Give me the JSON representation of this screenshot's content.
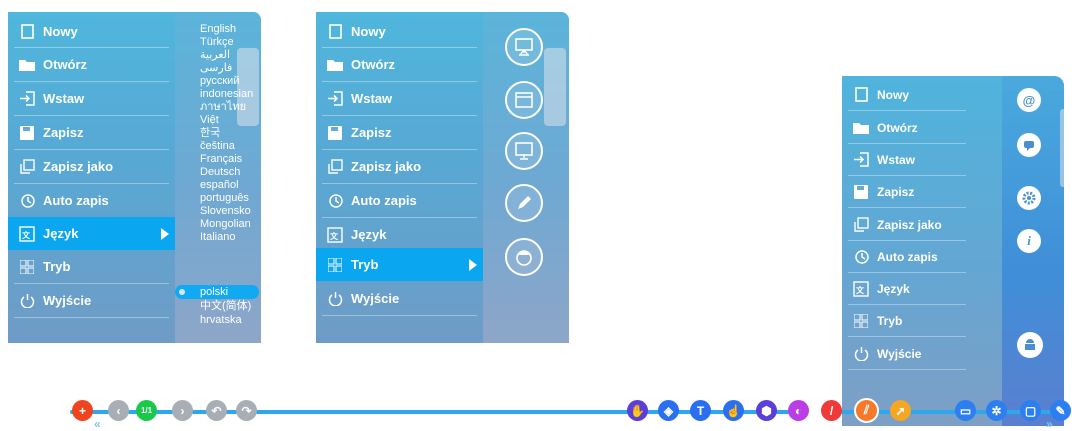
{
  "menu": {
    "new": "Nowy",
    "open": "Otwórz",
    "insert": "Wstaw",
    "save": "Zapisz",
    "save_as": "Zapisz jako",
    "auto_save": "Auto zapis",
    "language": "Język",
    "mode": "Tryb",
    "exit": "Wyjście"
  },
  "languages": [
    "English",
    "Türkçe",
    "العربية",
    "فارسی",
    "русский",
    "indonesian",
    "ภาษาไทย",
    "Việt",
    "한국",
    "čeština",
    "Français",
    "Deutsch",
    "español",
    "português",
    "Slovensko",
    "Mongolian",
    "Italiano",
    "polski",
    "中文(简体)",
    "hrvatska"
  ],
  "selected_language": "polski",
  "toolbar": {
    "page_indicator": "1/1"
  },
  "colors": {
    "accent": "#0aa6f0",
    "toolbar_bar": "#2ea7ee",
    "add_button": "#f0441f",
    "page_button": "#19c94a",
    "nav_gray": "#a9aeb5",
    "tool_purple": "#5b3fd6",
    "tool_blue": "#2a6ff0",
    "tool_magenta": "#b93ee6",
    "tool_pen_red": "#f03a3a",
    "tool_highlight_orange": "#f5792a",
    "tool_pointer_orange": "#f5a623",
    "right_tool_blue": "#2d7ef0"
  },
  "icons": {
    "mode_panel": [
      "monitor-stand-icon",
      "window-icon",
      "screen-icon",
      "pencil-icon",
      "face-icon"
    ],
    "right_panel": [
      "at-icon",
      "chat-icon",
      "settings-icon",
      "info-icon",
      "android-icon"
    ]
  }
}
